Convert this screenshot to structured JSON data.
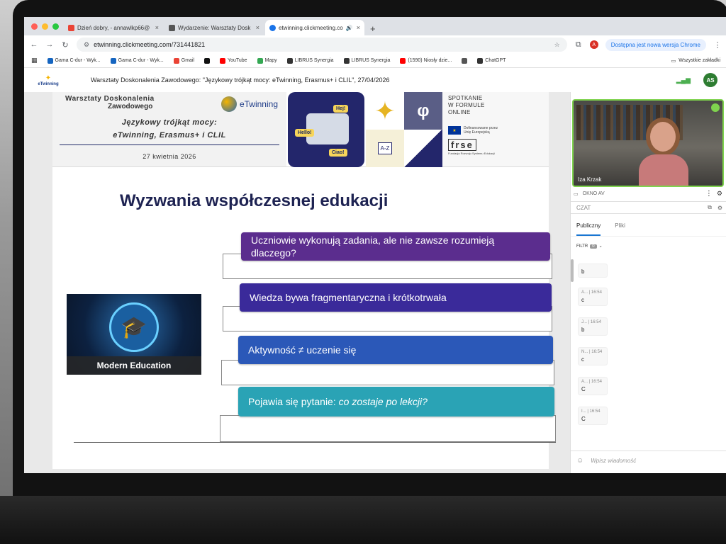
{
  "browser": {
    "tabs": [
      {
        "label": "Dzień dobry, - annawlkp66@",
        "color": "#ea4335"
      },
      {
        "label": "Wydarzenie: Warsztaty Dosk",
        "color": "#555555"
      },
      {
        "label": "etwinning.clickmeeting.co",
        "color": "#1a73e8"
      }
    ],
    "url": "etwinning.clickmeeting.com/731441821",
    "update_label": "Dostępna jest nowa wersja Chrome",
    "profile_initial": "A",
    "bookmarks": [
      {
        "label": "Gama C-dur - Wyk...",
        "color": "#1565c0"
      },
      {
        "label": "Gama C-dur - Wyk...",
        "color": "#1565c0"
      },
      {
        "label": "Gmail",
        "color": "#ea4335"
      },
      {
        "label": "",
        "color": "#111111"
      },
      {
        "label": "YouTube",
        "color": "#ff0000"
      },
      {
        "label": "Mapy",
        "color": "#34a853"
      },
      {
        "label": "LIBRUS Synergia",
        "color": "#333333"
      },
      {
        "label": "LIBRUS Synergia",
        "color": "#333333"
      },
      {
        "label": "(1590) Niosły dzie...",
        "color": "#ff0000"
      },
      {
        "label": "",
        "color": "#555555"
      },
      {
        "label": "ChatGPT",
        "color": "#333333"
      }
    ],
    "all_bookmarks": "Wszystkie zakładki"
  },
  "meeting": {
    "logo_text": "eTwinning",
    "title": "Warsztaty Doskonalenia Zawodowego: \"Językowy trójkąt mocy: eTwinning, Erasmus+ i CLIL\", 27/04/2026",
    "user_initials": "AS"
  },
  "slide": {
    "header_line1": "Warsztaty Doskonalenia",
    "header_line2": "Zawodowego",
    "etwinning_label": "eTwinning",
    "subtitle_line1": "Językowy trójkąt mocy:",
    "subtitle_line2": "eTwinning, Erasmus+ i CLIL",
    "date": "27 kwietnia 2026",
    "bubbles": [
      "Hej!",
      "Hello!",
      "Ciao!"
    ],
    "phi": "φ",
    "az_label": "A-Z",
    "meeting_format": "SPOTKANIE\nW FORMULE\nONLINE",
    "eu_text": "Dofinansowane przez Unię Europejską",
    "frse_label": "frse",
    "frse_sub": "Fundacja Rozwoju Systemu Edukacji",
    "main_title": "Wyzwania współczesnej edukacji",
    "image_label": "Modern Education",
    "bars": [
      {
        "text": "Uczniowie wykonują zadania, ale nie zawsze rozumieją dlaczego?",
        "color": "#5b2d8e",
        "italic_part": ""
      },
      {
        "text": "Wiedza bywa fragmentaryczna i krótkotrwała",
        "color": "#3a2a9a",
        "italic_part": ""
      },
      {
        "text": "Aktywność ≠ uczenie się",
        "color": "#2b58b8",
        "italic_part": ""
      },
      {
        "text": "Pojawia się pytanie: ",
        "color": "#2aa3b5",
        "italic_part": "co zostaje po lekcji?"
      }
    ]
  },
  "video": {
    "name": "Iza Krzak",
    "window_label": "OKNO AV"
  },
  "chat": {
    "title": "CZAT",
    "tabs": [
      "Publiczny",
      "Pliki"
    ],
    "filter_label": "FILTR",
    "filter_count": "0",
    "messages": [
      {
        "meta": "",
        "text": "b"
      },
      {
        "meta": "A... | 16:54",
        "text": "c"
      },
      {
        "meta": "J... | 16:54",
        "text": "b"
      },
      {
        "meta": "N... | 16:54",
        "text": "c"
      },
      {
        "meta": "A... | 16:54",
        "text": "C"
      },
      {
        "meta": "I... | 16:54",
        "text": "C"
      }
    ],
    "input_placeholder": "Wpisz wiadomość"
  }
}
